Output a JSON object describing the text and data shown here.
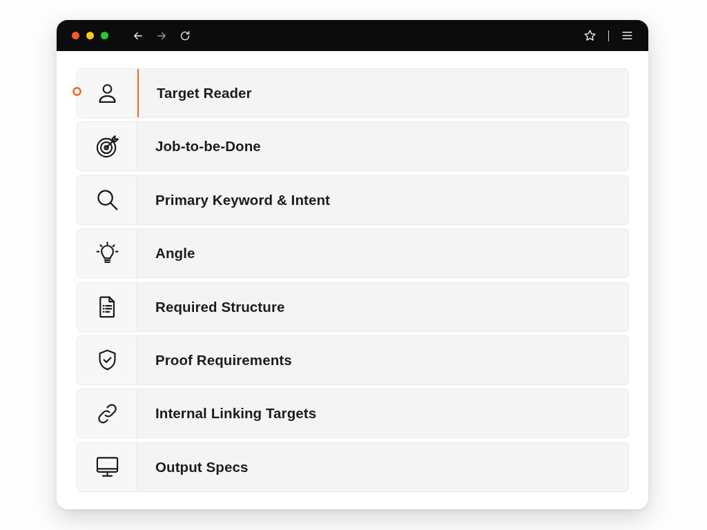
{
  "window": {
    "controls": [
      {
        "color": "#f4592a"
      },
      {
        "color": "#f6c71f"
      },
      {
        "color": "#2cc43a"
      }
    ],
    "navigation": [
      {
        "kind": "back",
        "disabled": false
      },
      {
        "kind": "forward",
        "disabled": true
      },
      {
        "kind": "reload",
        "disabled": false
      }
    ]
  },
  "items": [
    {
      "label": "Target Reader",
      "selected": true
    },
    {
      "label": "Job-to-be-Done",
      "selected": false
    },
    {
      "label": "Primary Keyword & Intent",
      "selected": false
    },
    {
      "label": "Angle",
      "selected": false
    },
    {
      "label": "Required Structure",
      "selected": false
    },
    {
      "label": "Proof Requirements",
      "selected": false
    },
    {
      "label": "Internal Linking Targets",
      "selected": false
    },
    {
      "label": "Output Specs",
      "selected": false
    }
  ]
}
